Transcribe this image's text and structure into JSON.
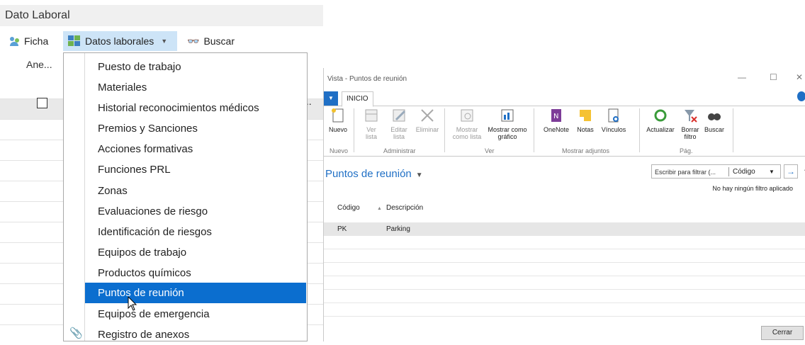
{
  "page": {
    "title": "Dato Laboral",
    "toolbar": {
      "ficha": "Ficha",
      "datos_laborales": "Datos laborales",
      "buscar": "Buscar"
    },
    "column_header": "Ane...",
    "truncated_cell": "..."
  },
  "menu": {
    "items": [
      {
        "label": "Puesto de trabajo"
      },
      {
        "label": "Materiales"
      },
      {
        "label": "Historial reconocimientos médicos"
      },
      {
        "label": "Premios y Sanciones"
      },
      {
        "label": "Acciones formativas"
      },
      {
        "label": "Funciones PRL"
      },
      {
        "label": "Zonas"
      },
      {
        "label": "Evaluaciones de riesgo"
      },
      {
        "label": "Identificación de riesgos"
      },
      {
        "label": "Equipos de trabajo"
      },
      {
        "label": "Productos químicos"
      },
      {
        "label": "Puntos de reunión",
        "active": true
      },
      {
        "label": "Equipos de emergencia"
      },
      {
        "label": "Registro de anexos"
      }
    ]
  },
  "dialog": {
    "window_title": "Vista - Puntos de reunión",
    "tab": "INICIO",
    "ribbon": {
      "buttons": {
        "nuevo": "Nuevo",
        "ver_lista": "Ver lista",
        "editar_lista": "Editar lista",
        "eliminar": "Eliminar",
        "mostrar_como_lista": "Mostrar como lista",
        "mostrar_como_grafico": "Mostrar como gráfico",
        "onenote": "OneNote",
        "notas": "Notas",
        "vinculos": "Vínculos",
        "actualizar": "Actualizar",
        "borrar_filtro": "Borrar filtro",
        "buscar": "Buscar"
      },
      "groups": {
        "nuevo": "Nuevo",
        "administrar": "Administrar",
        "ver": "Ver",
        "mostrar_adjuntos": "Mostrar adjuntos",
        "pag": "Pág."
      }
    },
    "list_title": "Puntos de reunión",
    "filter": {
      "placeholder": "Escribir para filtrar (...",
      "field": "Código"
    },
    "no_filter_text": "No hay ningún filtro aplicado",
    "columns": [
      "Código",
      "Descripción"
    ],
    "rows": [
      {
        "codigo": "PK",
        "descripcion": "Parking"
      }
    ],
    "close_button": "Cerrar"
  },
  "colors": {
    "accent": "#0b6ecf",
    "toolbar_highlight": "#cde4f7",
    "link_blue": "#1f6fc5"
  }
}
